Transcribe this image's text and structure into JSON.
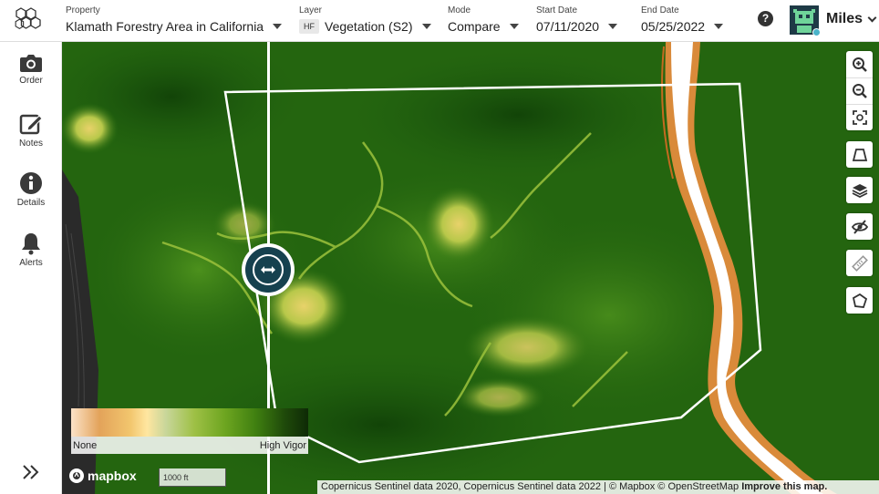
{
  "header": {
    "property": {
      "label": "Property",
      "value": "Klamath Forestry Area in California"
    },
    "layer": {
      "label": "Layer",
      "badge": "HF",
      "value": "Vegetation (S2)"
    },
    "mode": {
      "label": "Mode",
      "value": "Compare"
    },
    "start_date": {
      "label": "Start Date",
      "value": "07/11/2020"
    },
    "end_date": {
      "label": "End Date",
      "value": "05/25/2022"
    },
    "help_glyph": "?",
    "user": {
      "name": "Miles"
    }
  },
  "sidebar": {
    "items": [
      {
        "label": "Order",
        "icon": "camera-icon"
      },
      {
        "label": "Notes",
        "icon": "edit-icon"
      },
      {
        "label": "Details",
        "icon": "info-icon"
      },
      {
        "label": "Alerts",
        "icon": "bell-icon"
      }
    ],
    "expand_icon": "double-chevron-right-icon"
  },
  "map": {
    "controls": [
      "zoom-in-icon",
      "zoom-out-icon",
      "fit-bounds-icon",
      "trapezoid-icon",
      "layers-icon",
      "eye-off-icon",
      "ruler-icon",
      "polygon-icon"
    ],
    "legend": {
      "min_label": "None",
      "max_label": "High Vigor"
    },
    "brand": "mapbox",
    "scale": "1000 ft",
    "attribution": "Copernicus Sentinel data 2020, Copernicus Sentinel data 2022 | © Mapbox © OpenStreetMap",
    "improve_link": "Improve this map"
  },
  "colors": {
    "vegetation_dark": "#1e5c10",
    "vegetation_light": "#c8d65a",
    "river_orange": "#e3a35a",
    "handle": "#16414f",
    "avatar": "#1e3a46"
  }
}
